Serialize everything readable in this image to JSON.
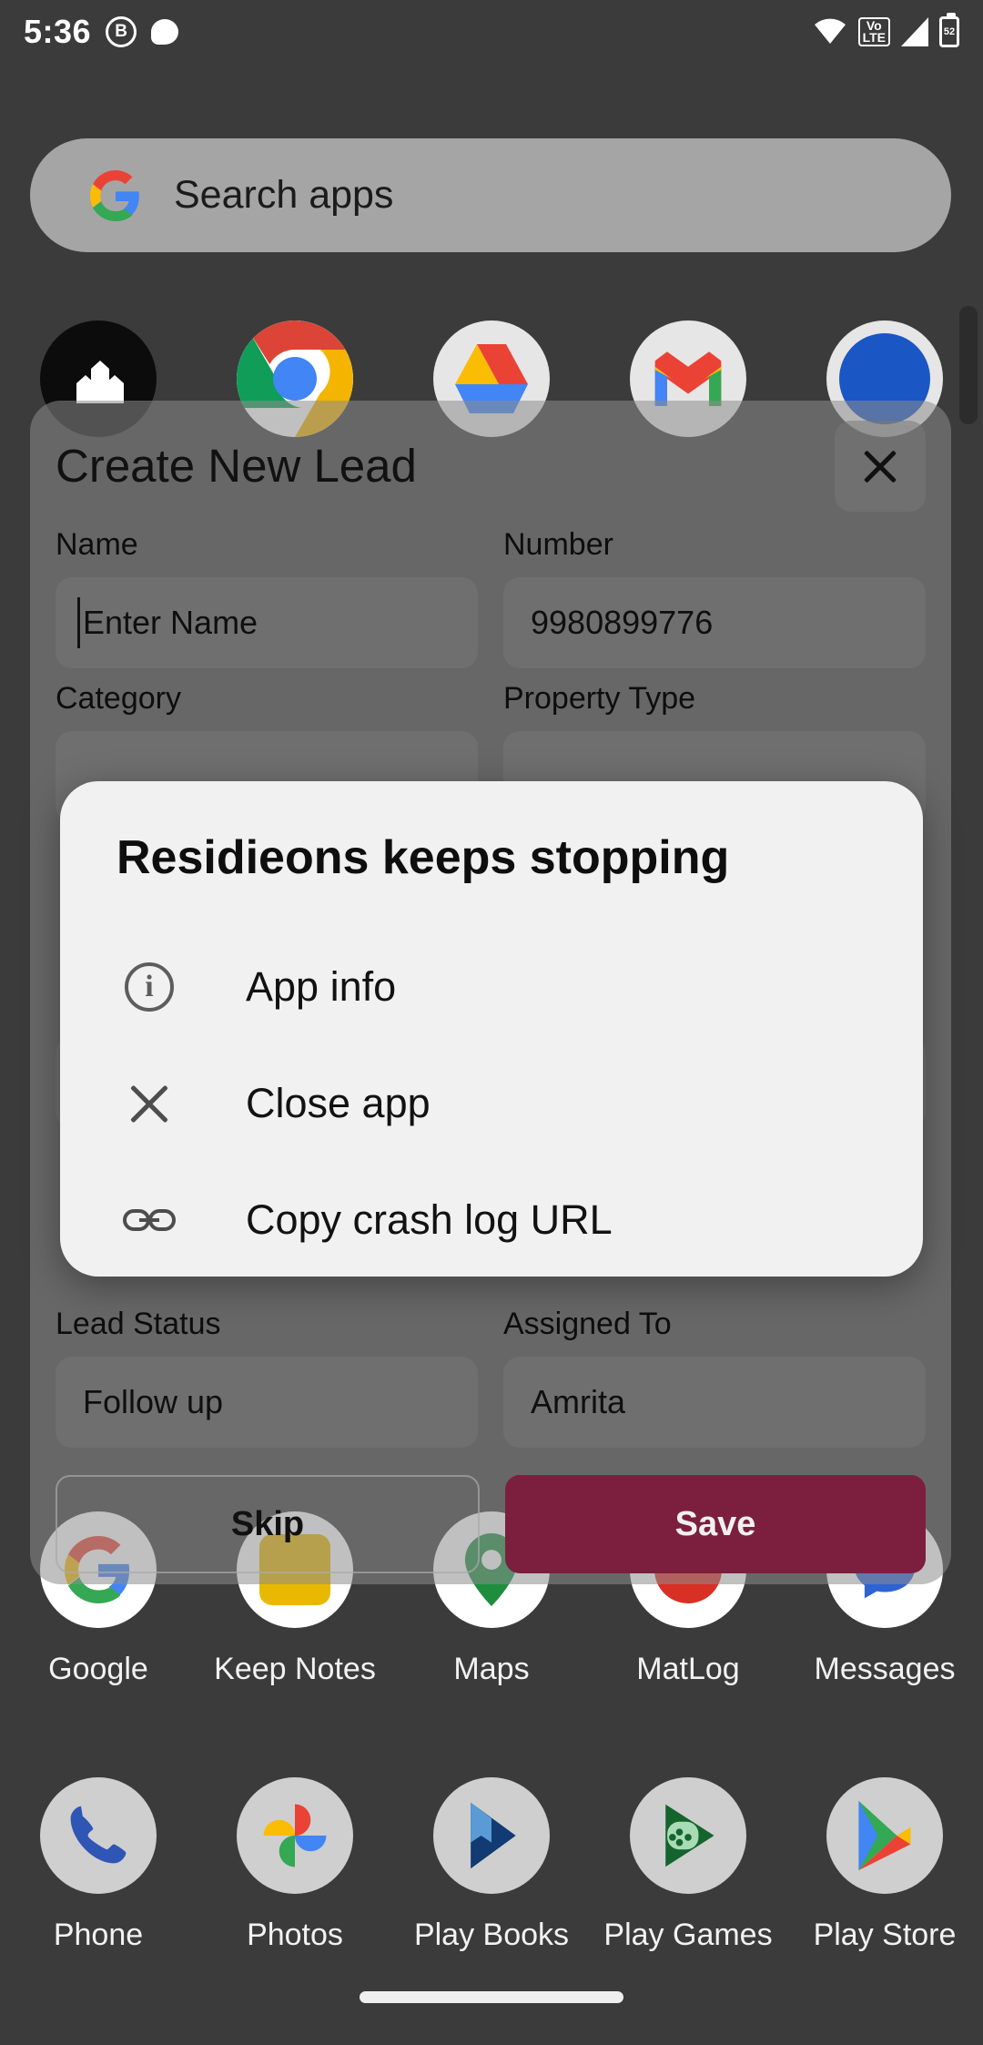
{
  "status_bar": {
    "time": "5:36",
    "left_icons": [
      {
        "name": "bluetooth-badge-icon",
        "glyph": "B"
      },
      {
        "name": "message-bubble-icon",
        "glyph": ""
      }
    ],
    "right_icons": [
      {
        "name": "wifi-icon",
        "glyph": ""
      },
      {
        "name": "volte-icon",
        "line1": "Vo",
        "line2": "LTE"
      },
      {
        "name": "cellular-signal-icon",
        "glyph": ""
      },
      {
        "name": "battery-icon",
        "glyph": ""
      }
    ]
  },
  "search": {
    "placeholder": "Search apps",
    "logo": "google-g-logo"
  },
  "app_rows": [
    {
      "row": "top-partial",
      "apps": [
        {
          "label": "",
          "icon": "analytics-app-icon",
          "colors": [
            "#0c0c0c"
          ]
        },
        {
          "label": "",
          "icon": "chrome-icon",
          "colors": [
            "#d93025",
            "#fbbc04",
            "#1a73e8",
            "#1e8e3e"
          ]
        },
        {
          "label": "",
          "icon": "drive-icon",
          "colors": [
            "#fbbc04",
            "#ea4335",
            "#1a73e8"
          ]
        },
        {
          "label": "",
          "icon": "gmail-icon",
          "colors": [
            "#ea4335",
            "#fbbc04",
            "#34a853",
            "#4285f4"
          ]
        },
        {
          "label": "",
          "icon": "generic-blue-icon",
          "colors": [
            "#1a56c4"
          ]
        }
      ]
    },
    {
      "row": "middle",
      "apps": [
        {
          "label": "Google",
          "icon": "google-icon",
          "colors": [
            "#1e8e3e"
          ]
        },
        {
          "label": "Keep Notes",
          "icon": "keep-notes-icon",
          "colors": [
            "#e8b900"
          ]
        },
        {
          "label": "Maps",
          "icon": "maps-icon",
          "colors": [
            "#1e8e3e"
          ]
        },
        {
          "label": "MatLog",
          "icon": "matlog-icon",
          "colors": [
            "#d93025"
          ]
        },
        {
          "label": "Messages",
          "icon": "messages-icon",
          "colors": [
            "#2e63d4"
          ]
        }
      ]
    },
    {
      "row": "bottom",
      "apps": [
        {
          "label": "Phone",
          "icon": "phone-icon",
          "colors": [
            "#2f55b5"
          ]
        },
        {
          "label": "Photos",
          "icon": "photos-icon",
          "colors": [
            "#ea4335",
            "#fbbc04",
            "#34a853",
            "#4285f4"
          ]
        },
        {
          "label": "Play Books",
          "icon": "play-books-icon",
          "colors": [
            "#123a73",
            "#5b9bd5"
          ]
        },
        {
          "label": "Play Games",
          "icon": "play-games-icon",
          "colors": [
            "#14642d",
            "#a8dcb5"
          ]
        },
        {
          "label": "Play Store",
          "icon": "play-store-icon",
          "colors": [
            "#34a853",
            "#fbbc04",
            "#ea4335",
            "#4285f4"
          ]
        }
      ]
    }
  ],
  "lead_sheet": {
    "title": "Create New Lead",
    "close_icon": "close-icon",
    "fields": [
      {
        "label": "Name",
        "value": "",
        "placeholder": "Enter Name",
        "focused": true
      },
      {
        "label": "Number",
        "value": "9980899776",
        "placeholder": ""
      },
      {
        "label": "Category",
        "value": "",
        "placeholder": ""
      },
      {
        "label": "Property Type",
        "value": "",
        "placeholder": ""
      },
      {
        "label": "Lead Status",
        "value": "Follow up",
        "placeholder": ""
      },
      {
        "label": "Assigned To",
        "value": "Amrita",
        "placeholder": ""
      }
    ],
    "buttons": {
      "skip_label": "Skip",
      "save_label": "Save",
      "save_color": "#7c1f3f"
    }
  },
  "crash_dialog": {
    "title": "Residieons keeps stopping",
    "options": [
      {
        "label": "App info",
        "icon": "info-icon"
      },
      {
        "label": "Close app",
        "icon": "close-icon"
      },
      {
        "label": "Copy crash log URL",
        "icon": "link-icon"
      }
    ]
  },
  "navigation": {
    "gesture_bar": "home-gesture-bar"
  }
}
